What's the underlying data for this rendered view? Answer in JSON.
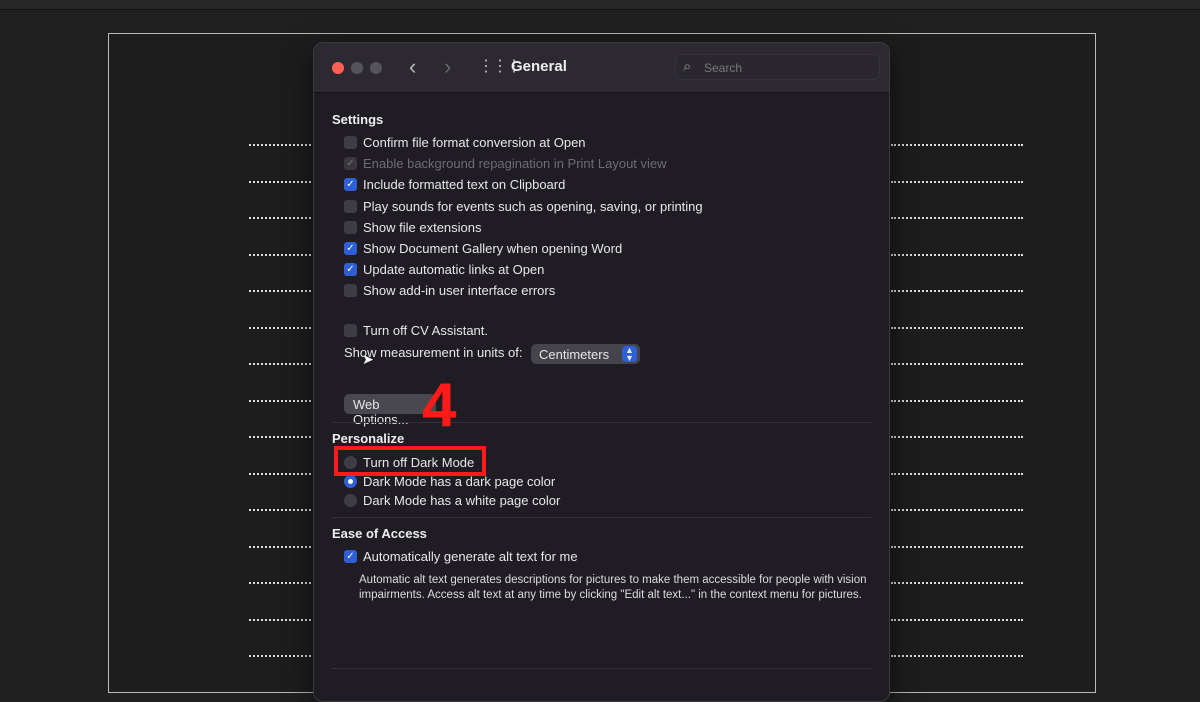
{
  "window": {
    "title": "General",
    "search_placeholder": "Search"
  },
  "settings": {
    "heading": "Settings",
    "items": [
      {
        "label": "Confirm file format conversion at Open",
        "checked": false
      },
      {
        "label": "Enable background repagination in Print Layout view",
        "checked": true,
        "disabled": true
      },
      {
        "label": "Include formatted text on Clipboard",
        "checked": true
      },
      {
        "label": "Play sounds for events such as opening, saving, or printing",
        "checked": false
      },
      {
        "label": "Show file extensions",
        "checked": false
      },
      {
        "label": "Show Document Gallery when opening Word",
        "checked": true
      },
      {
        "label": "Update automatic links at Open",
        "checked": true
      },
      {
        "label": "Show add-in user interface errors",
        "checked": false
      }
    ],
    "cv_assistant": {
      "label": "Turn off CV Assistant.",
      "checked": false
    },
    "units_label": "Show measurement in units of:",
    "units_value": "Centimeters",
    "web_options": "Web Options..."
  },
  "personalize": {
    "heading": "Personalize",
    "turn_off_dark": "Turn off Dark Mode",
    "dark_page": "Dark Mode has a dark page color",
    "white_page": "Dark Mode has a white page color",
    "selected": "dark_page"
  },
  "ease": {
    "heading": "Ease of Access",
    "alt_text": "Automatically generate alt text for me",
    "description": "Automatic alt text generates descriptions for pictures to make them accessible for people with vision impairments. Access alt text at any time by clicking \"Edit alt text...\" in the context menu for pictures."
  },
  "annotation": {
    "step": "4"
  }
}
